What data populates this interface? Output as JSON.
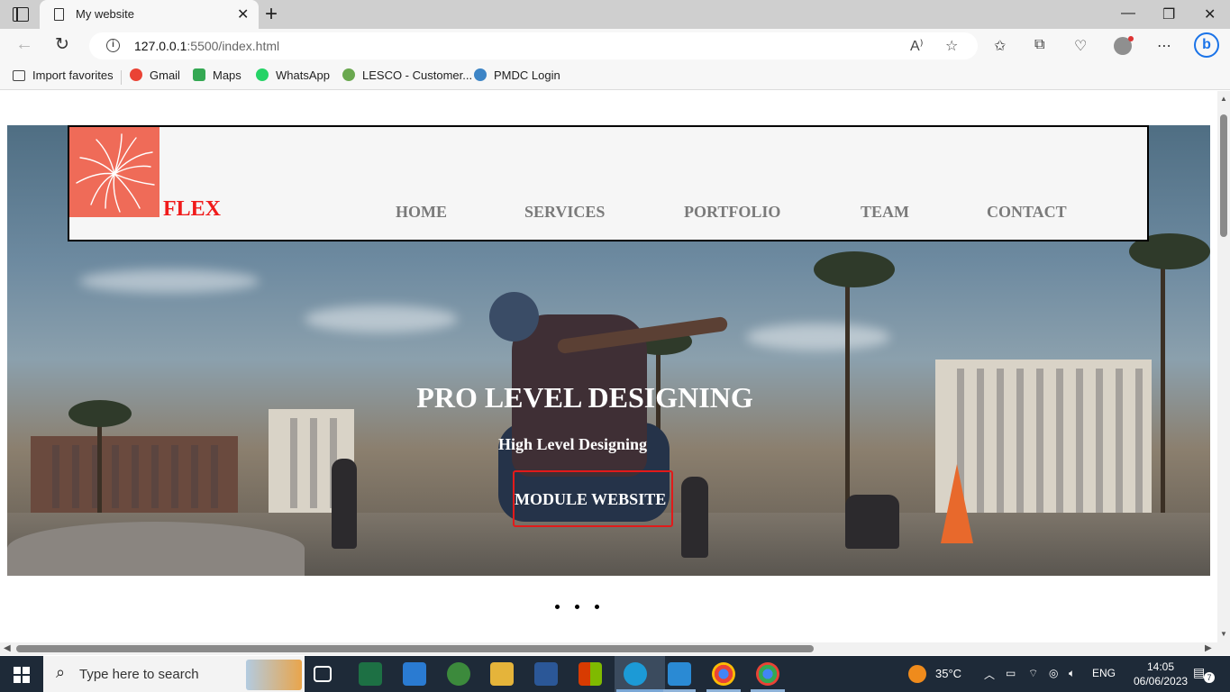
{
  "browser": {
    "tab_title": "My website",
    "url_host": "127.0.0.1",
    "url_path": ":5500/index.html",
    "favorites": [
      {
        "label": "Import favorites",
        "color": "#555555"
      },
      {
        "label": "Gmail",
        "color": "#ea4335"
      },
      {
        "label": "Maps",
        "color": "#34a853"
      },
      {
        "label": "WhatsApp",
        "color": "#25d366"
      },
      {
        "label": "LESCO - Customer...",
        "color": "#6aa84f"
      },
      {
        "label": "PMDC Login",
        "color": "#3d85c6"
      }
    ]
  },
  "site": {
    "brand": "FLEX",
    "nav": [
      "HOME",
      "SERVICES",
      "PORTFOLIO",
      "TEAM",
      "CONTACT"
    ],
    "hero_title": "PRO LEVEL DESIGNING",
    "hero_subtitle": "High Level Designing",
    "hero_button": "MODULE WEBSITE",
    "carousel_dots": 3,
    "colors": {
      "brand_red": "#f01b1b",
      "logo_bg": "#ef6b58",
      "nav_text": "#7a7a7a",
      "button_border": "#e21a1a"
    }
  },
  "taskbar": {
    "search_placeholder": "Type here to search",
    "weather": "35°C",
    "language": "ENG",
    "time": "14:05",
    "date": "06/06/2023",
    "notifications": "7",
    "apps": [
      "task-view",
      "excel",
      "mail",
      "xbox",
      "file-explorer",
      "word",
      "office",
      "edge",
      "vscode",
      "chrome-profile-b",
      "chrome"
    ]
  }
}
